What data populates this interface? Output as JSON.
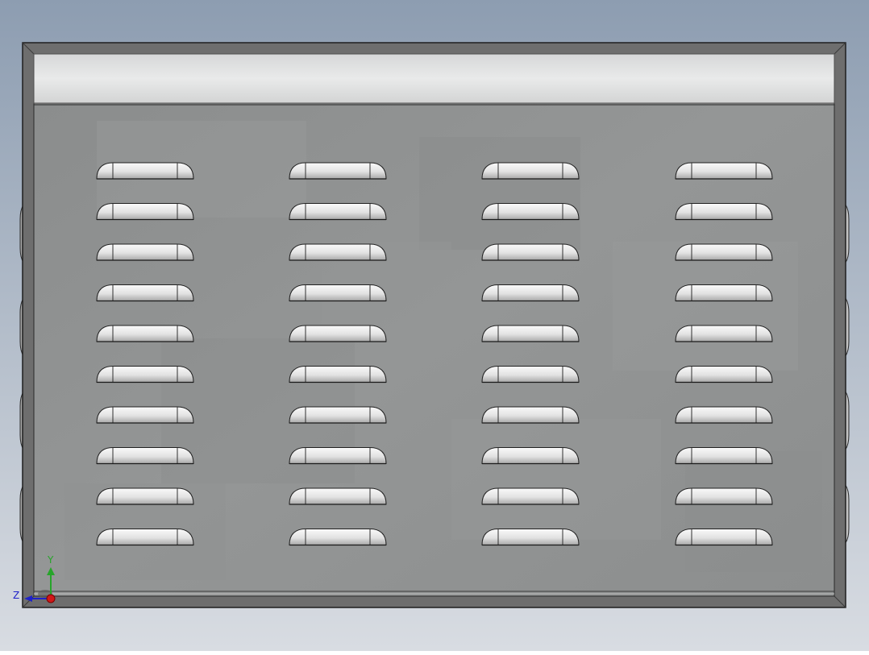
{
  "viewport": {
    "background_top": "#8d9db1",
    "background_bottom": "#d8dce2"
  },
  "model": {
    "type": "louvered-panel",
    "louver_columns": 4,
    "louver_rows": 10,
    "side_tabs_per_edge": 4,
    "frame_color": "#6e6e6e",
    "plate_color": "#8e9090",
    "top_strip_color": "#dcdddd",
    "louver_fill_color": "#e4e4e4",
    "louver_outline_color": "#202020"
  },
  "triad": {
    "y_label": "Y",
    "z_label": "Z",
    "y_color": "#27a52a",
    "z_color": "#1f22c9",
    "x_color": "#d01818"
  }
}
